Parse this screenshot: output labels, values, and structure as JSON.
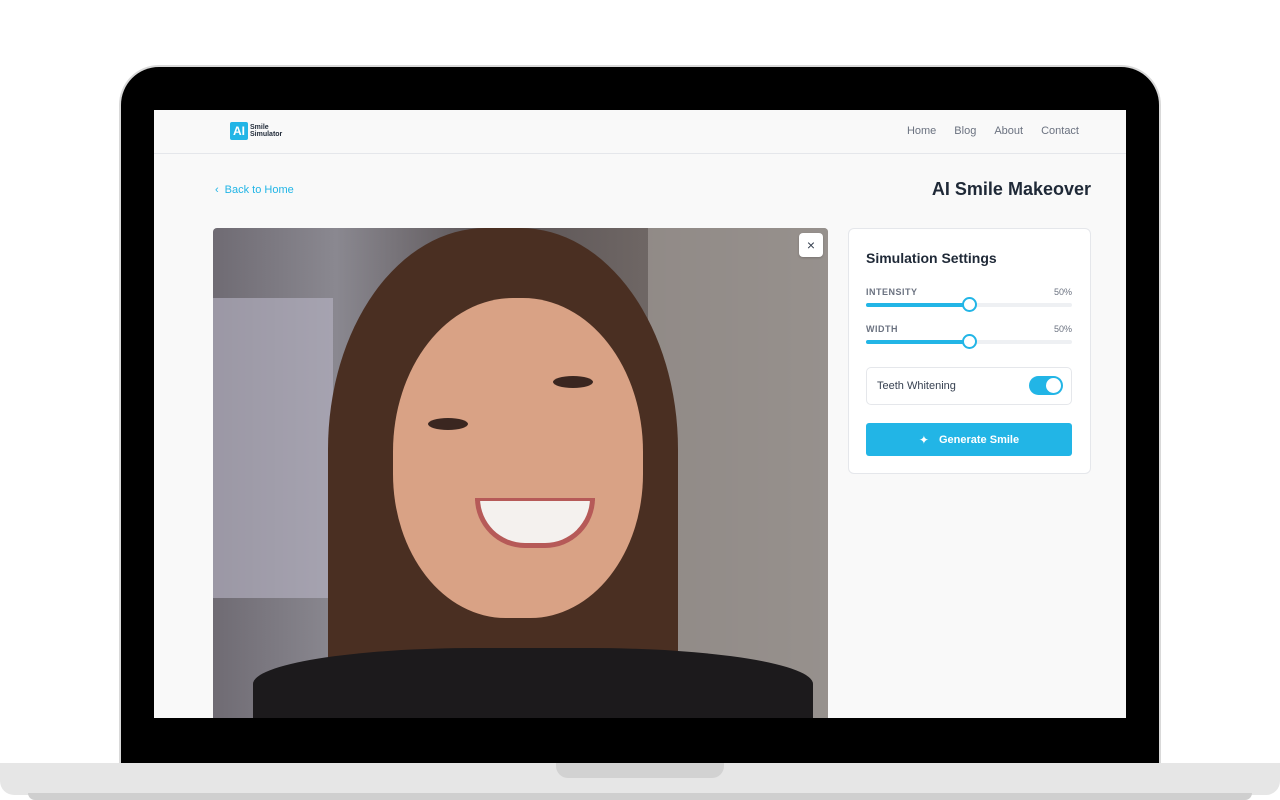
{
  "header": {
    "logo_badge": "AI",
    "logo_line1": "Smile",
    "logo_line2": "Simulator",
    "nav": [
      "Home",
      "Blog",
      "About",
      "Contact"
    ]
  },
  "page": {
    "back_label": "Back to Home",
    "title": "AI Smile Makeover",
    "close_label": "×"
  },
  "settings": {
    "title": "Simulation Settings",
    "intensity": {
      "label": "INTENSITY",
      "value_text": "50%",
      "value": 0.5
    },
    "width": {
      "label": "WIDTH",
      "value_text": "50%",
      "value": 0.5
    },
    "whitening": {
      "label": "Teeth Whitening",
      "on": true
    },
    "generate_label": "Generate Smile"
  },
  "colors": {
    "accent": "#22b5e6",
    "title": "#1f2937"
  }
}
